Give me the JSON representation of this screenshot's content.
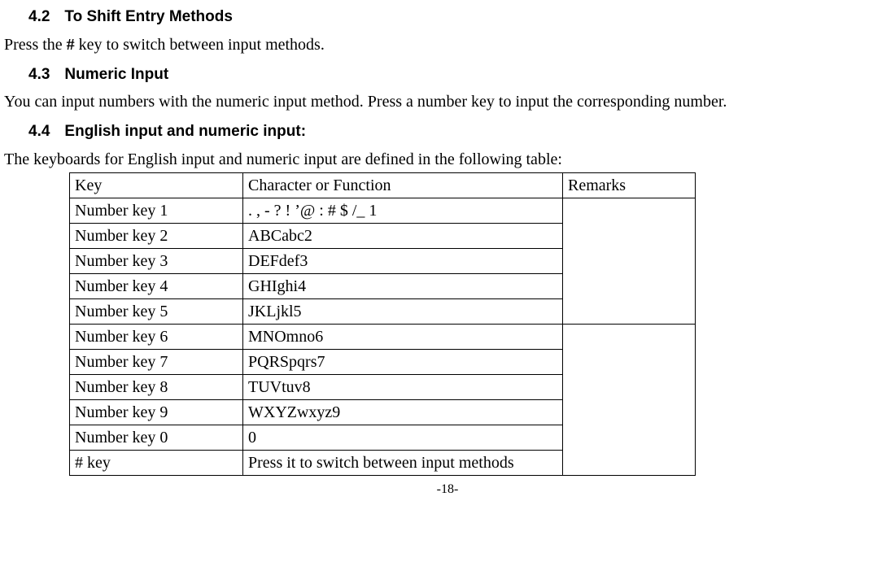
{
  "sections": {
    "s42": {
      "num": "4.2",
      "title": "To Shift Entry Methods"
    },
    "s43": {
      "num": "4.3",
      "title": "Numeric Input"
    },
    "s44": {
      "num": "4.4",
      "title": "English input and numeric input:"
    }
  },
  "paragraphs": {
    "p42a": "Press the ",
    "p42hash": "#",
    "p42b": " key to switch between input methods.",
    "p43": "You can input numbers with the numeric input method. Press a number key to input the corresponding number.",
    "p44": "The keyboards for English input and numeric input are defined in the following table:"
  },
  "table": {
    "headers": {
      "key": "Key",
      "char": "Character or Function",
      "remarks": "Remarks"
    },
    "rows": [
      {
        "key": "Number key 1",
        "char": ". , - ? ! ’@ : # $ /_ 1"
      },
      {
        "key": "Number key 2",
        "char": "ABCabc2"
      },
      {
        "key": "Number key 3",
        "char": "DEFdef3"
      },
      {
        "key": "Number key 4",
        "char": "GHIghi4"
      },
      {
        "key": "Number key 5",
        "char": "JKLjkl5"
      },
      {
        "key": "Number key 6",
        "char": "MNOmno6"
      },
      {
        "key": "Number key 7",
        "char": "PQRSpqrs7"
      },
      {
        "key": "Number key 8",
        "char": "TUVtuv8"
      },
      {
        "key": "Number key 9",
        "char": "WXYZwxyz9"
      },
      {
        "key": "Number key 0",
        "char": "0"
      },
      {
        "key": "# key",
        "char": "Press it to switch between input methods"
      }
    ]
  },
  "footer": "-18-"
}
